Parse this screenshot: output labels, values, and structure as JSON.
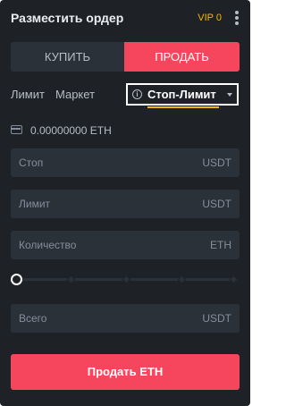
{
  "header": {
    "title": "Разместить ордер",
    "vip": "VIP 0",
    "more_icon": "vertical-dots-icon"
  },
  "side_toggle": {
    "buy_label": "КУПИТЬ",
    "sell_label": "ПРОДАТЬ",
    "active": "sell"
  },
  "order_types": {
    "limit": "Лимит",
    "market": "Маркет",
    "stop_limit": "Стоп-Лимит",
    "active": "stop_limit",
    "info_icon": "info-icon",
    "dropdown_icon": "caret-down-icon"
  },
  "balance": {
    "icon": "wallet-icon",
    "text": "0.00000000 ETH"
  },
  "fields": {
    "stop": {
      "label": "Стоп",
      "unit": "USDT"
    },
    "limit": {
      "label": "Лимит",
      "unit": "USDT"
    },
    "quantity": {
      "label": "Количество",
      "unit": "ETH"
    },
    "total": {
      "label": "Всего",
      "unit": "USDT"
    }
  },
  "slider": {
    "value_percent": 0,
    "ticks": [
      0,
      25,
      50,
      75,
      100
    ]
  },
  "submit": {
    "label": "Продать ETH"
  },
  "colors": {
    "panel_bg": "#1e2126",
    "input_bg": "#2b3139",
    "sell_red": "#f6465d",
    "accent_yellow": "#f0b90b",
    "text_primary": "#eaecef",
    "text_muted": "#848e9c"
  }
}
